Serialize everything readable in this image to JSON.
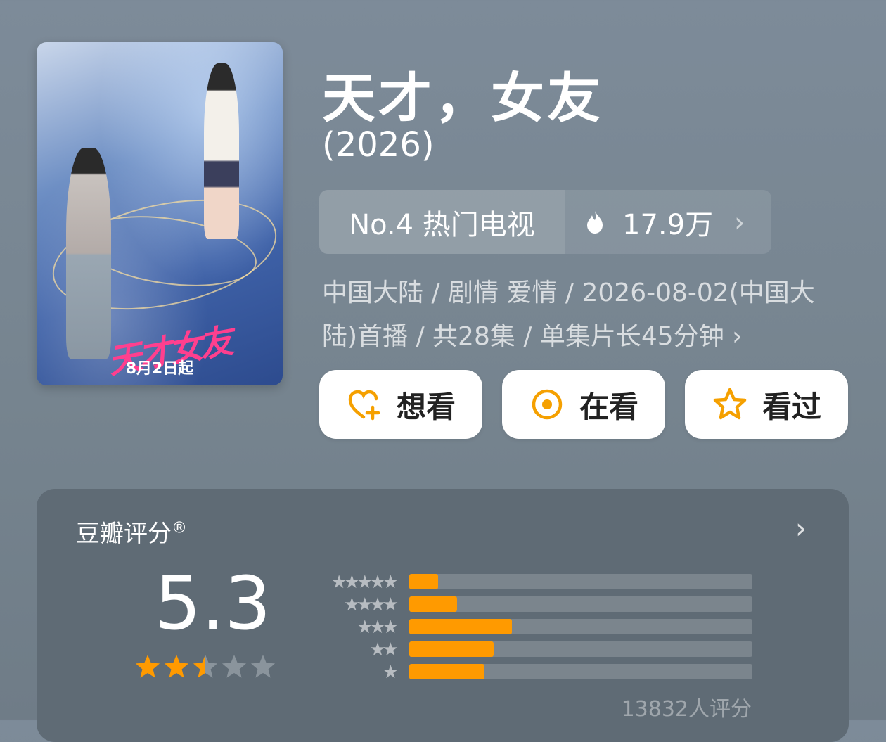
{
  "poster": {
    "caption": "8月2日起",
    "logo_text": "天才女友"
  },
  "header": {
    "title": "天才，女友",
    "year": "(2026)"
  },
  "rank": {
    "label": "No.4 热门电视",
    "heat": "17.9万",
    "chevron": "›"
  },
  "meta": {
    "line1": "中国大陆 / 剧情 爱情 / 2026-08-02(中国大",
    "line2": "陆)首播 / 共28集 / 单集片长45分钟 ›"
  },
  "actions": [
    {
      "label": "想看",
      "icon": "heart-plus-icon"
    },
    {
      "label": "在看",
      "icon": "target-icon"
    },
    {
      "label": "看过",
      "icon": "star-outline-icon"
    }
  ],
  "rating": {
    "title": "豆瓣评分",
    "reg": "®",
    "chevron": "›",
    "score": "5.3",
    "stars": 2.5,
    "count_text": "13832人评分",
    "distribution": [
      {
        "label": "★★★★★",
        "fraction": 0.083
      },
      {
        "label": "★★★★",
        "fraction": 0.14
      },
      {
        "label": "★★★",
        "fraction": 0.3
      },
      {
        "label": "★★",
        "fraction": 0.245
      },
      {
        "label": "★",
        "fraction": 0.22
      }
    ]
  },
  "colors": {
    "accent": "#ff9a00",
    "card": "#5f6b75",
    "background": "#7a8896"
  }
}
